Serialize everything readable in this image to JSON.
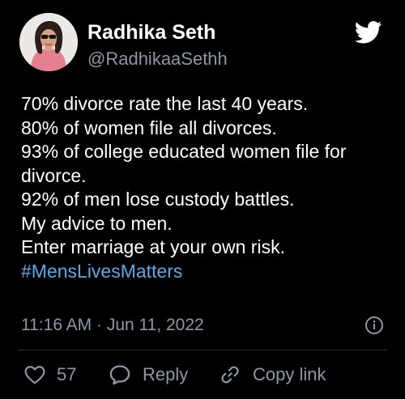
{
  "user": {
    "display_name": "Radhika Seth",
    "handle": "@RadhikaaSethh",
    "avatar_icon": "profile-photo"
  },
  "tweet": {
    "lines": [
      "70% divorce rate the last 40 years.",
      "80% of women file all divorces.",
      "93% of college educated women file for",
      "divorce.",
      "92% of men lose custody battles.",
      "My advice to men.",
      "Enter marriage at your own risk."
    ],
    "hashtag": "#MensLivesMatters"
  },
  "meta": {
    "timestamp": "11:16 AM · Jun 11, 2022"
  },
  "actions": {
    "like_count": "57",
    "reply_label": "Reply",
    "copy_link_label": "Copy link"
  },
  "icons": {
    "brand": "twitter-bird-icon",
    "info": "info-icon",
    "like": "heart-icon",
    "reply": "speech-bubble-icon",
    "copy": "link-icon"
  },
  "colors": {
    "background": "#000000",
    "text_primary": "#ffffff",
    "text_secondary": "#8b98a5",
    "accent": "#5aa9e6",
    "divider": "#2f3336"
  }
}
